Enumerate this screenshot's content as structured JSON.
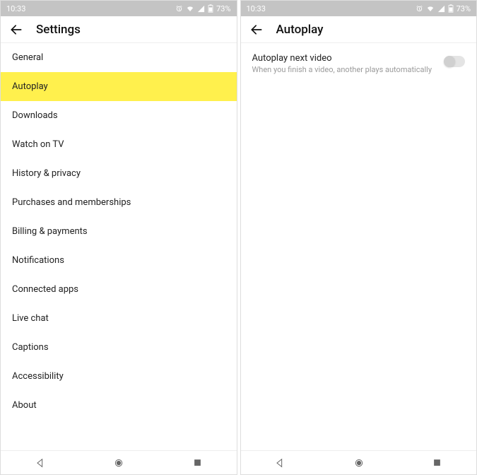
{
  "status": {
    "time": "10:33",
    "battery_pct": "73%"
  },
  "left_screen": {
    "title": "Settings",
    "items": [
      {
        "label": "General",
        "highlight": false
      },
      {
        "label": "Autoplay",
        "highlight": true
      },
      {
        "label": "Downloads",
        "highlight": false
      },
      {
        "label": "Watch on TV",
        "highlight": false
      },
      {
        "label": "History & privacy",
        "highlight": false
      },
      {
        "label": "Purchases and memberships",
        "highlight": false
      },
      {
        "label": "Billing & payments",
        "highlight": false
      },
      {
        "label": "Notifications",
        "highlight": false
      },
      {
        "label": "Connected apps",
        "highlight": false
      },
      {
        "label": "Live chat",
        "highlight": false
      },
      {
        "label": "Captions",
        "highlight": false
      },
      {
        "label": "Accessibility",
        "highlight": false
      },
      {
        "label": "About",
        "highlight": false
      }
    ]
  },
  "right_screen": {
    "title": "Autoplay",
    "setting": {
      "primary": "Autoplay next video",
      "secondary": "When you finish a video, another plays automatically",
      "enabled": false
    }
  }
}
